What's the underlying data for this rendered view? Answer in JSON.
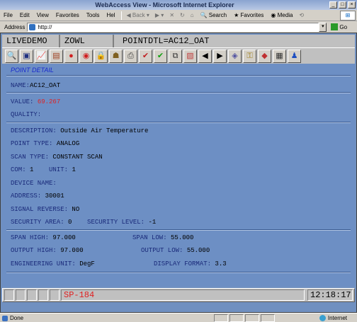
{
  "window": {
    "title": "WebAccess View - Microsoft Internet Explorer"
  },
  "menu": {
    "items": [
      "File",
      "Edit",
      "View",
      "Favorites",
      "Tools",
      "Hel"
    ],
    "back": "Back",
    "search": "Search",
    "favorites": "Favorites",
    "media": "Media"
  },
  "address": {
    "label": "Address",
    "value": "http://",
    "go": "Go"
  },
  "header": {
    "node": "LIVEDEMO",
    "station": "ZOWL",
    "display": "POINTDTL=AC12_OAT"
  },
  "toolbar_icons": [
    "magnifier-icon",
    "save-icon",
    "trend-icon",
    "chart-icon",
    "alarm-red-icon",
    "alarm-ack-icon",
    "lock-icon",
    "user-icon",
    "print-icon",
    "check-red-icon",
    "check-green-icon",
    "copy-icon",
    "graph-icon",
    "arrow-left-icon",
    "arrow-right-icon",
    "tag-icon",
    "key-icon",
    "eraser-icon",
    "film-icon",
    "person-icon"
  ],
  "detail": {
    "heading": "POINT DETAIL",
    "name_label": "NAME:",
    "name": "AC12_OAT",
    "value_label": "VALUE:",
    "value": "69.267",
    "quality_label": "QUALITY:",
    "description_label": "DESCRIPTION:",
    "description": "Outside Air Temperature",
    "point_type_label": "POINT TYPE:",
    "point_type": "ANALOG",
    "scan_type_label": "SCAN TYPE:",
    "scan_type": "CONSTANT SCAN",
    "com_label": "COM:",
    "com": "1",
    "unit_label": "UNIT:",
    "unit": "1",
    "device_name_label": "DEVICE NAME:",
    "address_label": "ADDRESS:",
    "address": "30001",
    "signal_reverse_label": "SIGNAL REVERSE:",
    "signal_reverse": "NO",
    "security_area_label": "SECURITY AREA:",
    "security_area": "0",
    "security_level_label": "SECURITY LEVEL:",
    "security_level": "-1",
    "span_high_label": "SPAN HIGH:",
    "span_high": "97.000",
    "span_low_label": "SPAN LOW:",
    "span_low": "55.000",
    "output_high_label": "OUTPUT HIGH:",
    "output_high": "97.000",
    "output_low_label": "OUTPUT LOW:",
    "output_low": "55.000",
    "eng_unit_label": "ENGINEERING UNIT:",
    "eng_unit": "DegF",
    "display_format_label": "DISPLAY FORMAT:",
    "display_format": "3.3"
  },
  "status": {
    "code": "SP-184",
    "time": "12:18:17"
  },
  "ie_status": {
    "text": "Done",
    "zone": "Internet"
  }
}
